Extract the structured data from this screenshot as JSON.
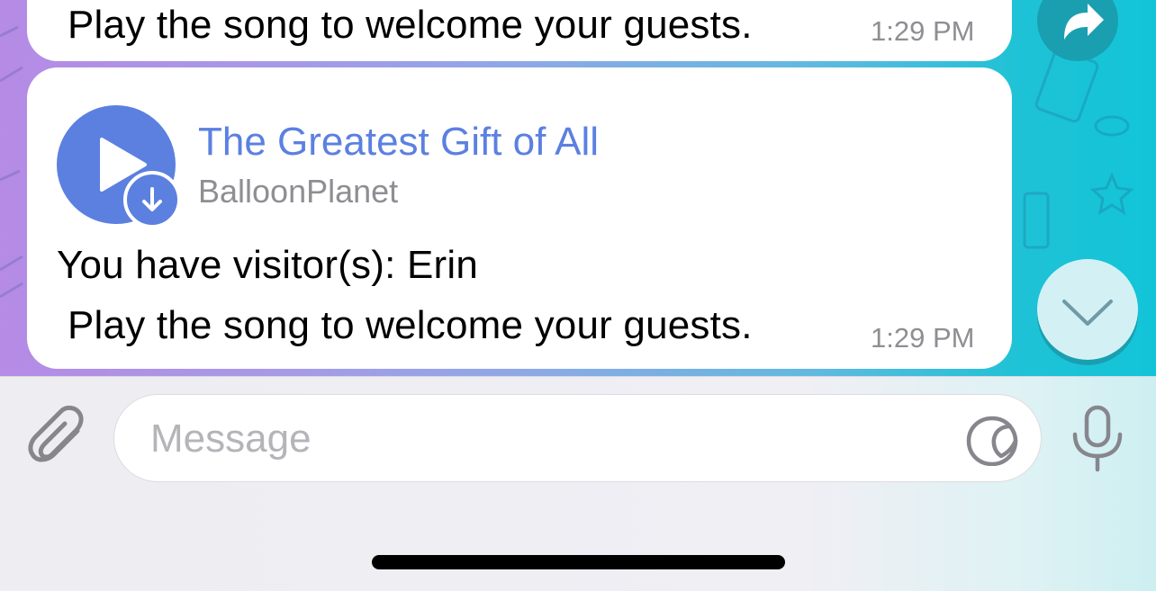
{
  "messages": {
    "previous": {
      "line2": "Play the song to welcome your guests.",
      "time": "1:29 PM"
    },
    "current": {
      "audio": {
        "title": "The Greatest Gift of All",
        "artist": "BalloonPlanet"
      },
      "line1": "You have visitor(s): Erin",
      "line2": "Play the song to welcome your guests.",
      "time": "1:29 PM"
    }
  },
  "composer": {
    "placeholder": "Message",
    "value": ""
  },
  "icons": {
    "forward": "forward-icon",
    "scroll_down": "chevron-down-icon",
    "attach": "paperclip-icon",
    "sticker": "sticker-icon",
    "mic": "microphone-icon",
    "play": "play-icon",
    "download": "download-icon"
  },
  "colors": {
    "accent": "#5b80e0",
    "time_gray": "#8e8e93",
    "bubble_bg": "#ffffff"
  }
}
